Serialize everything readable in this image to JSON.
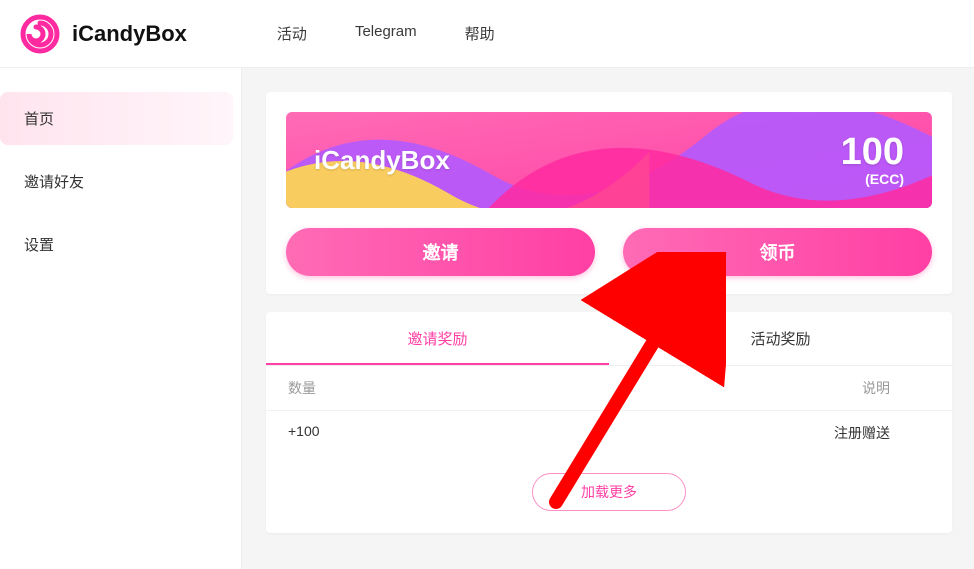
{
  "brand": {
    "title": "iCandyBox"
  },
  "topnav": {
    "items": [
      {
        "label": "活动"
      },
      {
        "label": "Telegram"
      },
      {
        "label": "帮助"
      }
    ]
  },
  "sidebar": {
    "items": [
      {
        "label": "首页",
        "active": true
      },
      {
        "label": "邀请好友",
        "active": false
      },
      {
        "label": "设置",
        "active": false
      }
    ]
  },
  "banner": {
    "title": "iCandyBox",
    "amount": "100",
    "unit": "(ECC)"
  },
  "cta": {
    "invite_label": "邀请",
    "claim_label": "领币"
  },
  "rewards": {
    "tabs": [
      {
        "label": "邀请奖励",
        "active": true
      },
      {
        "label": "活动奖励",
        "active": false
      }
    ],
    "columns": {
      "amount_header": "数量",
      "desc_header": "说明"
    },
    "rows": [
      {
        "amount": "+100",
        "desc": "注册赠送"
      }
    ],
    "load_more_label": "加载更多"
  },
  "colors": {
    "accent_pink": "#ff3fa4",
    "accent_pink_light": "#ff6bb5",
    "purple": "#b45aff",
    "yellow": "#ffd84d",
    "sidebar_active_bg": "#ffe4ee"
  }
}
